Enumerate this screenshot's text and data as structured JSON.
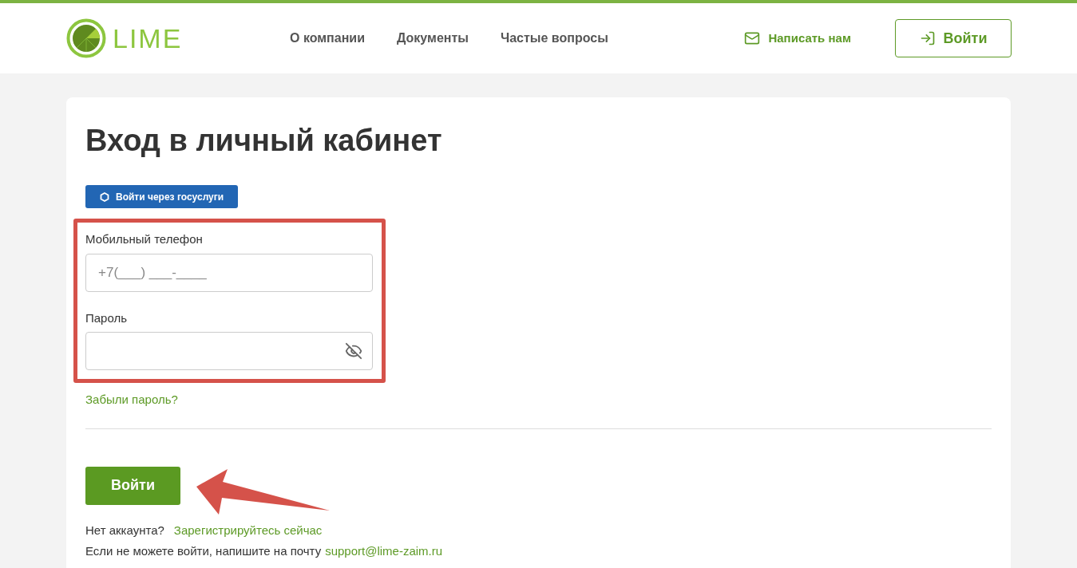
{
  "header": {
    "logo_text": "LIME",
    "nav": [
      "О компании",
      "Документы",
      "Частые вопросы"
    ],
    "contact_link": "Написать нам",
    "login_button": "Войти"
  },
  "card": {
    "title": "Вход в личный кабинет",
    "gosuslugi_button": "Войти через госуслуги",
    "fields": [
      {
        "kind": "phone",
        "label": "Мобильный телефон",
        "placeholder": "+7(___) ___-____"
      },
      {
        "kind": "password",
        "label": "Пароль"
      }
    ],
    "forgot_link": "Забыли пароль?",
    "submit_button": "Войти",
    "register": {
      "text": "Нет аккаунта?",
      "link": "Зарегистрируйтесь сейчас"
    },
    "support": {
      "text": "Если не можете войти, напишите на почту",
      "email": "support@lime-zaim.ru"
    }
  }
}
